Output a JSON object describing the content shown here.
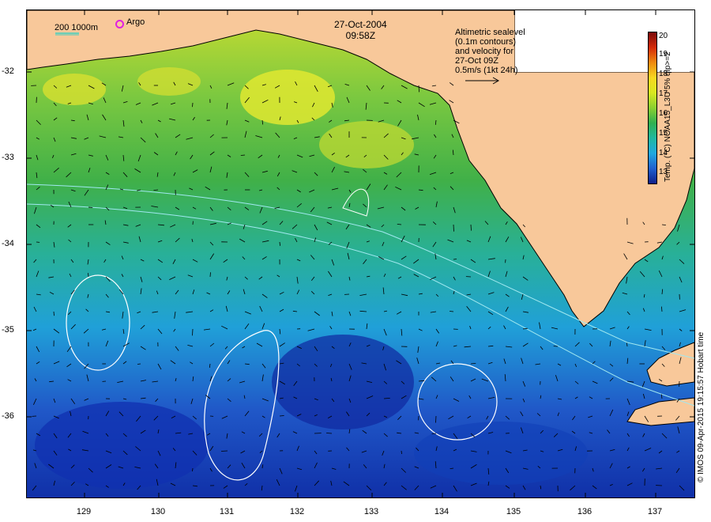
{
  "map": {
    "date": "27-Oct-2004",
    "time": "09:58Z",
    "legend_lines": [
      "Altimetric sealevel",
      "(0.1m contours)",
      "and velocity for",
      "27-Oct 09Z",
      "0.5m/s (1kt 24h)"
    ],
    "scale_label": "200  1000m",
    "argo_label": "Argo",
    "lat_labels": [
      "-32",
      "-33",
      "-34",
      "-35",
      "-36"
    ],
    "lon_labels": [
      "129",
      "130",
      "131",
      "132",
      "133",
      "134",
      "135",
      "136",
      "137"
    ],
    "colorbar": {
      "title": "Temp. (°C) NOAA15_L3U 5% qlp>=2",
      "ticks": [
        "20",
        "19",
        "18",
        "17",
        "16",
        "15",
        "14",
        "13"
      ]
    },
    "credit": "© IMOS 09-Apr-2015 19:15:57 Hobart time",
    "colors": {
      "land": "#f8c89a",
      "warm": "#d8e030",
      "mid": "#40b040",
      "cool": "#20a8d8",
      "cold": "#1038c0",
      "argo": "#e020e0"
    }
  }
}
